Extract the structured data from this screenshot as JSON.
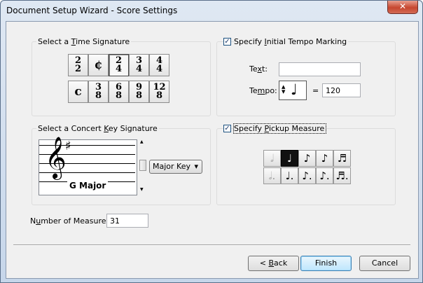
{
  "window": {
    "title": "Document Setup Wizard - Score Settings",
    "close_glyph": "✕"
  },
  "time_sig": {
    "heading_pre": "Select a ",
    "heading_u": "T",
    "heading_post": "ime Signature",
    "buttons": [
      {
        "top": "2",
        "bottom": "2"
      },
      {
        "single": "¢"
      },
      {
        "top": "2",
        "bottom": "4"
      },
      {
        "top": "3",
        "bottom": "4"
      },
      {
        "top": "4",
        "bottom": "4"
      },
      {
        "single": "c"
      },
      {
        "top": "3",
        "bottom": "8"
      },
      {
        "top": "6",
        "bottom": "8"
      },
      {
        "top": "9",
        "bottom": "8"
      },
      {
        "top": "12",
        "bottom": "8"
      }
    ],
    "selected_index": 2
  },
  "tempo": {
    "checkbox_checked": true,
    "label_pre": "Specify ",
    "label_u": "I",
    "label_post": "nitial Tempo Marking",
    "text_label_pre": "Te",
    "text_label_u": "x",
    "text_label_post": "t:",
    "text_value": "",
    "tempo_label_pre": "Te",
    "tempo_label_u": "m",
    "tempo_label_post": "po:",
    "note_glyph": "♩",
    "equals": "=",
    "value": "120"
  },
  "key_sig": {
    "heading_pre": "Select a Concert ",
    "heading_u": "K",
    "heading_post": "ey Signature",
    "clef_glyph": "𝄞",
    "sharp_glyph": "♯",
    "key_name": "G Major",
    "mode_value": "Major Key",
    "mode_arrow": "▾"
  },
  "pickup": {
    "checkbox_checked": true,
    "label_pre": "Specify ",
    "label_u": "P",
    "label_post": "ickup Measure",
    "notes_row1": [
      "𝅗𝅥",
      "♩",
      "♪",
      "♪",
      "♬"
    ],
    "notes_row2": [
      "𝅗𝅥.",
      "♩.",
      "♪.",
      "♪.",
      "♬."
    ],
    "selected_index": 1
  },
  "measures": {
    "label_pre": "N",
    "label_u": "u",
    "label_post": "mber of Measures:",
    "value": "31"
  },
  "footer": {
    "back_label_pre": "< ",
    "back_label_u": "B",
    "back_label_post": "ack",
    "finish_label": "Finish",
    "cancel_label": "Cancel"
  }
}
